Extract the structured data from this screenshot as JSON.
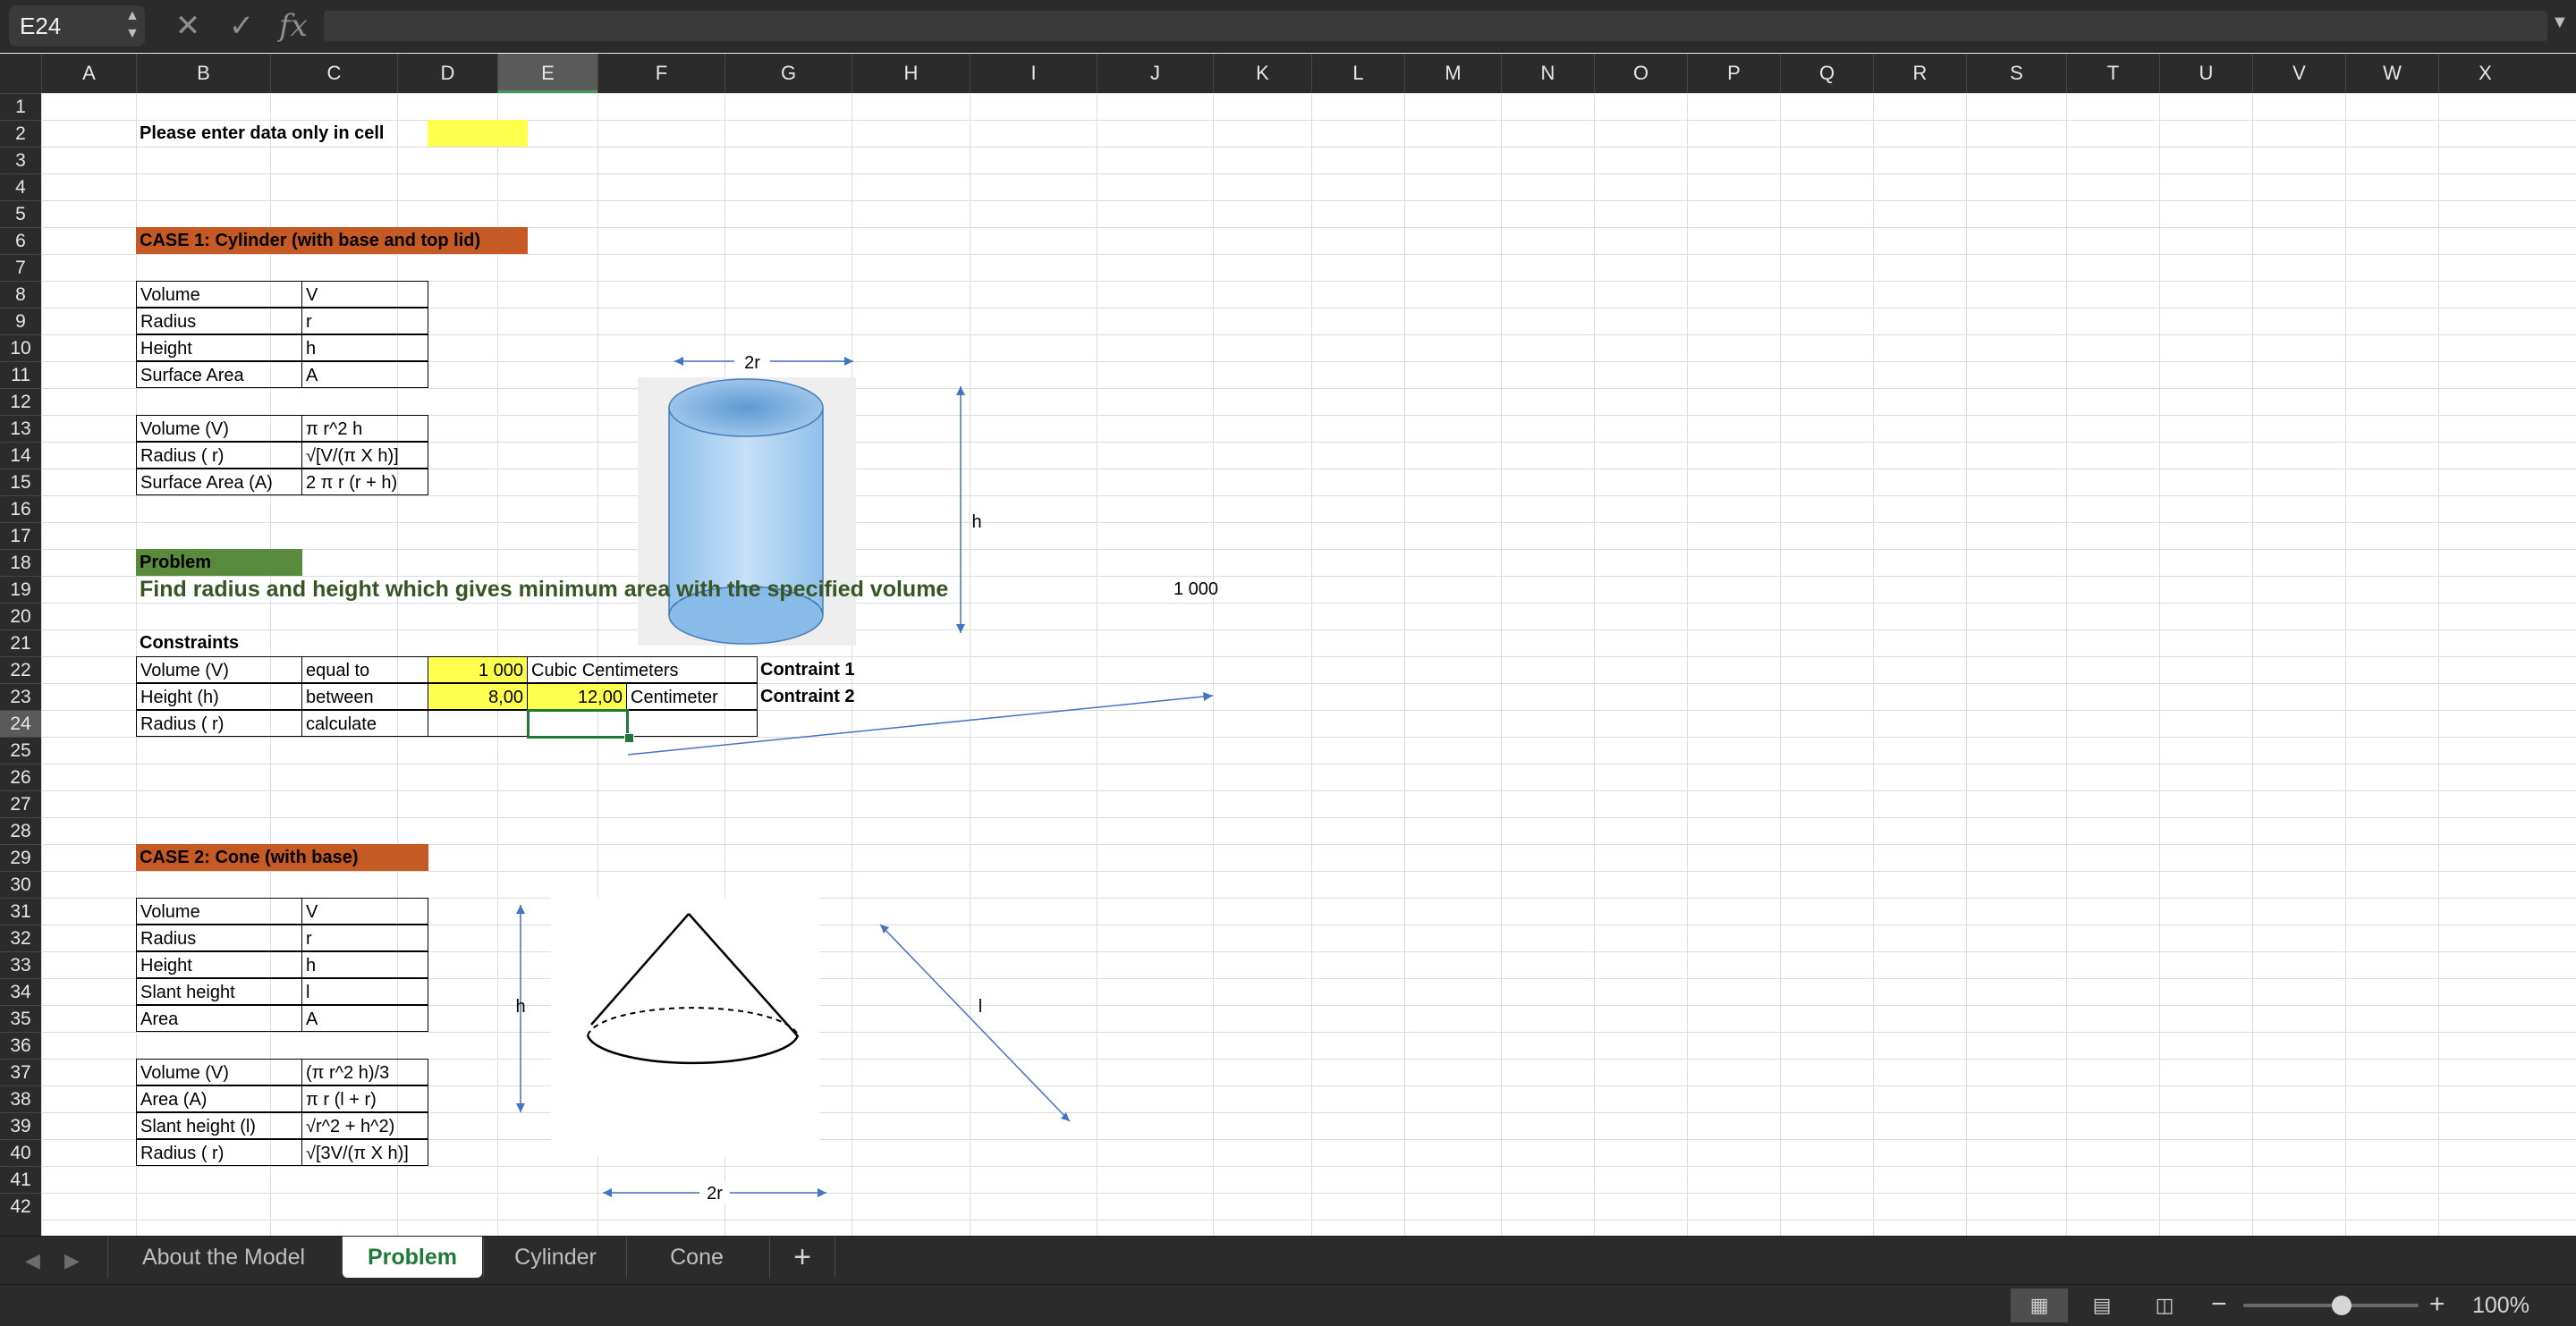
{
  "formula_bar": {
    "name_box": "E24",
    "fx": "fx",
    "formula": ""
  },
  "columns": [
    "A",
    "B",
    "C",
    "D",
    "E",
    "F",
    "G",
    "H",
    "I",
    "J",
    "K",
    "L",
    "M",
    "N",
    "O",
    "P",
    "Q",
    "R",
    "S",
    "T",
    "U",
    "V",
    "W",
    "X"
  ],
  "selected_column": "E",
  "rows": [
    "1",
    "2",
    "3",
    "4",
    "5",
    "6",
    "7",
    "8",
    "9",
    "10",
    "11",
    "12",
    "13",
    "14",
    "15",
    "16",
    "17",
    "18",
    "19",
    "20",
    "21",
    "22",
    "23",
    "24",
    "25",
    "26",
    "27",
    "28",
    "29",
    "30",
    "31",
    "32",
    "33",
    "34",
    "35",
    "36",
    "37",
    "38",
    "39",
    "40",
    "41",
    "42"
  ],
  "selected_row": "24",
  "sheet": {
    "instruction": "Please enter data only in cell",
    "case1": {
      "title": "CASE 1: Cylinder (with base and top lid)",
      "defs": [
        {
          "label": "Volume",
          "symbol": "V"
        },
        {
          "label": "Radius",
          "symbol": "r"
        },
        {
          "label": "Height",
          "symbol": "h"
        },
        {
          "label": "Surface Area",
          "symbol": "A"
        }
      ],
      "formulas": [
        {
          "label": "Volume (V)",
          "formula": "π r^2  h"
        },
        {
          "label": "Radius ( r)",
          "formula": "√[V/(π X h)]"
        },
        {
          "label": "Surface Area (A)",
          "formula": "2 π r (r + h)"
        }
      ],
      "diagram": {
        "top_label": "2r",
        "side_label": "h"
      }
    },
    "problem": {
      "label": "Problem",
      "title": "Find radius and height which gives minimum area with the specified volume",
      "arrow_value": "1 000"
    },
    "constraints": {
      "header": "Constraints",
      "rows": [
        {
          "label": "Volume (V)",
          "type": "equal to",
          "v1": "1 000",
          "v2": "",
          "unit": "Cubic Centimeters",
          "note": "Contraint 1"
        },
        {
          "label": "Height (h)",
          "type": "between",
          "v1": "8,00",
          "v2": "12,00",
          "unit": "Centimeter",
          "note": "Contraint 2"
        },
        {
          "label": "Radius ( r)",
          "type": "calculate",
          "v1": "",
          "v2": "",
          "unit": "",
          "note": ""
        }
      ]
    },
    "case2": {
      "title": "CASE 2: Cone (with base)",
      "defs": [
        {
          "label": "Volume",
          "symbol": "V"
        },
        {
          "label": "Radius",
          "symbol": "r"
        },
        {
          "label": "Height",
          "symbol": "h"
        },
        {
          "label": "Slant height",
          "symbol": "l"
        },
        {
          "label": "Area",
          "symbol": "A"
        }
      ],
      "formulas": [
        {
          "label": "Volume (V)",
          "formula": "(π r^2  h)/3"
        },
        {
          "label": "Area (A)",
          "formula": "π r (l + r)"
        },
        {
          "label": "Slant height (l)",
          "formula": "√r^2 + h^2)"
        },
        {
          "label": "Radius ( r)",
          "formula": "√[3V/(π X h)]"
        }
      ],
      "diagram": {
        "h_label": "h",
        "l_label": "l",
        "bottom_label": "2r"
      }
    }
  },
  "tabs": {
    "items": [
      "About the Model",
      "Problem",
      "Cylinder",
      "Cone"
    ],
    "active": "Problem",
    "add": "+"
  },
  "status": {
    "zoom": "100%",
    "zoom_fraction": 0.5
  },
  "colors": {
    "accent": "#1f7a3a",
    "case_header": "#c65a25",
    "problem_header": "#5a8a3c",
    "input_yellow": "#ffff4d",
    "title_green": "#375623"
  }
}
